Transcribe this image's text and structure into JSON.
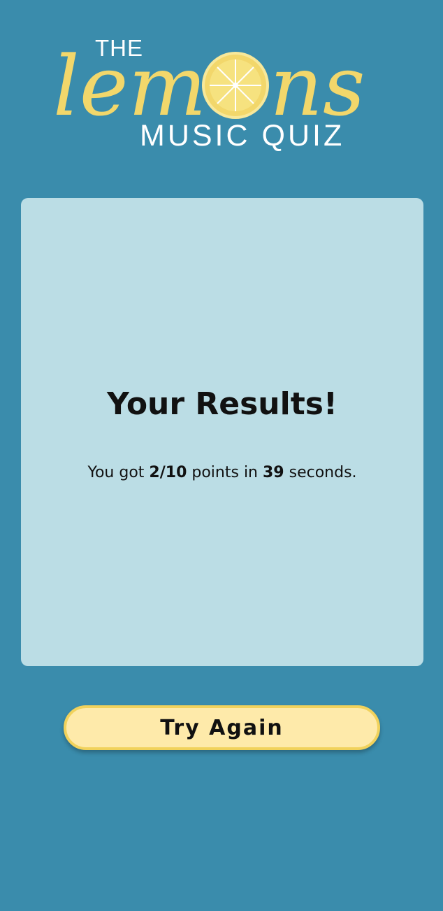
{
  "app": {
    "logo": {
      "the": "THE",
      "brand": "lemons",
      "subtitle": "MUSIC QUIZ"
    }
  },
  "results": {
    "title": "Your Results!",
    "sentence_prefix": "You got ",
    "score": "2/10",
    "sentence_middle": " points in ",
    "seconds": "39",
    "sentence_suffix": " seconds."
  },
  "actions": {
    "try_again_label": "Try Again"
  },
  "colors": {
    "background": "#3a8cac",
    "card": "#bbdde5",
    "lemon_yellow": "#f2d76b",
    "button_fill": "#feeaaa",
    "button_border": "#f1d25c"
  }
}
